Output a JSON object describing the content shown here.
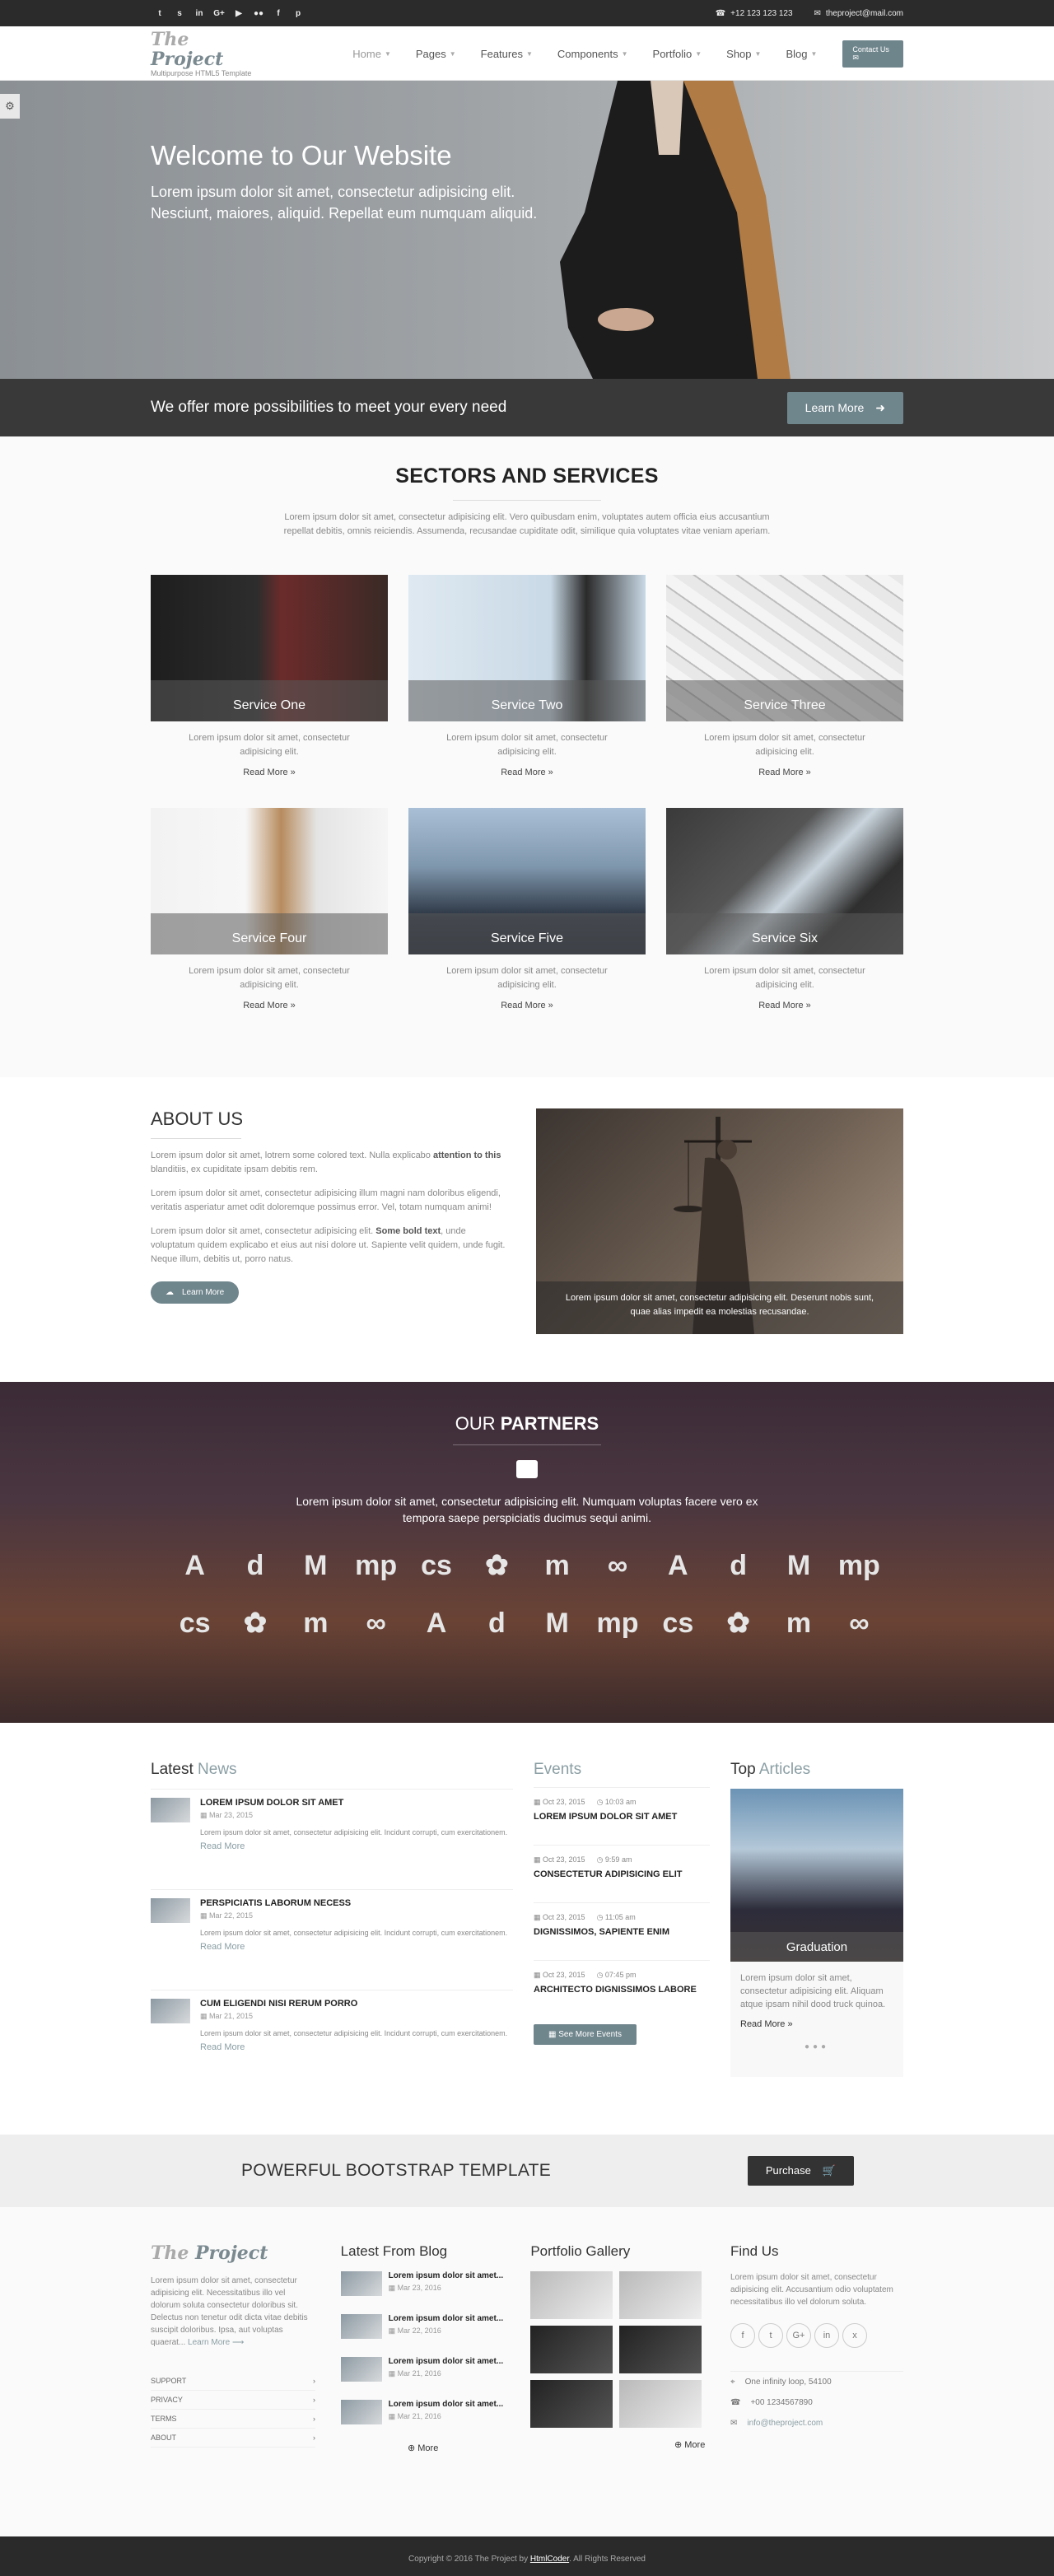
{
  "topbar": {
    "socials": [
      "twitter",
      "skype",
      "linkedin",
      "google-plus",
      "youtube",
      "flickr",
      "facebook",
      "pinterest"
    ],
    "social_glyphs": [
      "t",
      "s",
      "in",
      "G+",
      "▶",
      "●●",
      "f",
      "p"
    ],
    "phone": "+12 123 123 123",
    "email": "theproject@mail.com"
  },
  "header": {
    "logo_a": "The ",
    "logo_b": "Project",
    "logo_sub": "Multipurpose HTML5 Template",
    "nav": [
      "Home",
      "Pages",
      "Features",
      "Components",
      "Portfolio",
      "Shop",
      "Blog"
    ],
    "contact_btn": "Contact Us"
  },
  "hero": {
    "title": "Welcome to Our Website",
    "text": "Lorem ipsum dolor sit amet, consectetur adipisicing elit. Nesciunt, maiores, aliquid. Repellat eum numquam aliquid."
  },
  "strip": {
    "text": "We offer more possibilities to meet your every need",
    "button": "Learn More"
  },
  "services": {
    "title": "SECTORS AND SERVICES",
    "desc": "Lorem ipsum dolor sit amet, consectetur adipisicing elit. Vero quibusdam enim, voluptates autem officia eius accusantium repellat debitis, omnis reiciendis. Assumenda, recusandae cupiditate odit, similique quia voluptates vitae veniam aperiam.",
    "items": [
      {
        "label": "Service One",
        "text": "Lorem ipsum dolor sit amet, consectetur adipisicing elit.",
        "more": "Read More »"
      },
      {
        "label": "Service Two",
        "text": "Lorem ipsum dolor sit amet, consectetur adipisicing elit.",
        "more": "Read More »"
      },
      {
        "label": "Service Three",
        "text": "Lorem ipsum dolor sit amet, consectetur adipisicing elit.",
        "more": "Read More »"
      },
      {
        "label": "Service Four",
        "text": "Lorem ipsum dolor sit amet, consectetur adipisicing elit.",
        "more": "Read More »"
      },
      {
        "label": "Service Five",
        "text": "Lorem ipsum dolor sit amet, consectetur adipisicing elit.",
        "more": "Read More »"
      },
      {
        "label": "Service Six",
        "text": "Lorem ipsum dolor sit amet, consectetur adipisicing elit.",
        "more": "Read More »"
      }
    ]
  },
  "about": {
    "title": "ABOUT US",
    "p1a": "Lorem ipsum dolor sit amet, lotrem some colored text. Nulla explicabo ",
    "p1b": "attention to this",
    "p1c": " blanditiis, ex cupiditate ipsam debitis rem.",
    "p2": "Lorem ipsum dolor sit amet, consectetur adipisicing illum magni nam doloribus eligendi, veritatis asperiatur amet odit doloremque possimus error. Vel, totam numquam animi!",
    "p3a": "Lorem ipsum dolor sit amet, consectetur adipisicing elit. ",
    "p3b": "Some bold text",
    "p3c": ", unde voluptatum quidem explicabo et eius aut nisi dolore ut. Sapiente velit quidem, unde fugit. Neque illum, debitis ut, porro natus.",
    "button": "Learn More",
    "caption": "Lorem ipsum dolor sit amet, consectetur adipisicing elit. Deserunt nobis sunt, quae alias impedit ea molestias recusandae."
  },
  "partners": {
    "title_a": "OUR ",
    "title_b": "PARTNERS",
    "text": "Lorem ipsum dolor sit amet, consectetur adipisicing elit. Numquam voluptas facere vero ex tempora saepe perspiciatis ducimus sequi animi.",
    "logos": [
      "A",
      "d",
      "M",
      "mp",
      "cs",
      "✿",
      "m",
      "∞",
      "A",
      "d",
      "M",
      "mp",
      "cs",
      "✿",
      "m",
      "∞",
      "A",
      "d",
      "M",
      "mp",
      "cs",
      "✿",
      "m",
      "∞"
    ]
  },
  "news": {
    "title_a": "Latest ",
    "title_b": "News",
    "items": [
      {
        "title": "LOREM IPSUM DOLOR SIT AMET",
        "date": "Mar 23, 2015",
        "text": "Lorem ipsum dolor sit amet, consectetur adipisicing elit. Incidunt corrupti, cum exercitationem.",
        "more": "Read More"
      },
      {
        "title": "PERSPICIATIS LABORUM NECESS",
        "date": "Mar 22, 2015",
        "text": "Lorem ipsum dolor sit amet, consectetur adipisicing elit. Incidunt corrupti, cum exercitationem.",
        "more": "Read More"
      },
      {
        "title": "CUM ELIGENDI NISI RERUM PORRO",
        "date": "Mar 21, 2015",
        "text": "Lorem ipsum dolor sit amet, consectetur adipisicing elit. Incidunt corrupti, cum exercitationem.",
        "more": "Read More"
      }
    ]
  },
  "events": {
    "title": "Events",
    "items": [
      {
        "date": "Oct 23, 2015",
        "time": "10:03 am",
        "title": "LOREM IPSUM DOLOR SIT AMET"
      },
      {
        "date": "Oct 23, 2015",
        "time": "9:59 am",
        "title": "CONSECTETUR ADIPISICING ELIT"
      },
      {
        "date": "Oct 23, 2015",
        "time": "11:05 am",
        "title": "DIGNISSIMOS, SAPIENTE ENIM"
      },
      {
        "date": "Oct 23, 2015",
        "time": "07:45 pm",
        "title": "ARCHITECTO DIGNISSIMOS LABORE"
      }
    ],
    "button": "See More Events"
  },
  "articles": {
    "title_a": "Top ",
    "title_b": "Articles",
    "label": "Graduation",
    "text": "Lorem ipsum dolor sit amet, consectetur adipisicing elit. Aliquam atque ipsam nihil dood truck quinoa.",
    "more": "Read More »",
    "dots": "●●●"
  },
  "purchase": {
    "text": "POWERFUL BOOTSTRAP TEMPLATE",
    "button": "Purchase"
  },
  "footer": {
    "about_text": "Lorem ipsum dolor sit amet, consectetur adipisicing elit. Necessitatibus illo vel dolorum soluta consectetur doloribus sit. Delectus non tenetur odit dicta vitae debitis suscipit doloribus. Ipsa, aut voluptas quaerat... ",
    "about_link": "Learn More ⟶",
    "menu": [
      "SUPPORT",
      "PRIVACY",
      "TERMS",
      "ABOUT"
    ],
    "blog_title": "Latest From Blog",
    "blog": [
      {
        "title": "Lorem ipsum dolor sit amet...",
        "date": "Mar 23, 2016"
      },
      {
        "title": "Lorem ipsum dolor sit amet...",
        "date": "Mar 22, 2016"
      },
      {
        "title": "Lorem ipsum dolor sit amet...",
        "date": "Mar 21, 2016"
      },
      {
        "title": "Lorem ipsum dolor sit amet...",
        "date": "Mar 21, 2016"
      }
    ],
    "more": "More",
    "gallery_title": "Portfolio Gallery",
    "find_title": "Find Us",
    "find_text": "Lorem ipsum dolor sit amet, consectetur adipisicing elit. Accusantium odio voluptatem necessitatibus illo vel dolorum soluta.",
    "find_icons": [
      "f",
      "t",
      "G+",
      "in",
      "x"
    ],
    "address": "One infinity loop, 54100",
    "phone": "+00 1234567890",
    "email": "info@theproject.com"
  },
  "copyright": {
    "a": "Copyright © 2016 The Project by ",
    "b": "HtmlCoder",
    "c": ". All Rights Reserved"
  }
}
